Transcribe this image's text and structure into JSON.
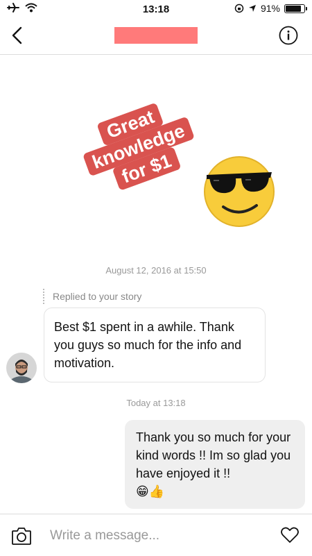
{
  "status_bar": {
    "time": "13:18",
    "battery_text": "91%",
    "battery_level": 0.91
  },
  "story": {
    "sticker_lines": [
      "Great",
      "knowledge",
      "for $1"
    ],
    "emoji": "sunglasses-face"
  },
  "thread": {
    "story_date": "August 12, 2016 at 15:50",
    "replied_label": "Replied to your story",
    "incoming_message": "Best $1 spent in a awhile. Thank you guys so much for the info and motivation.",
    "today_label": "Today at 13:18",
    "outgoing_message": "Thank you so much for your kind words !! Im so glad you have enjoyed it !!",
    "outgoing_emojis": "😁👍"
  },
  "composer": {
    "placeholder": "Write a message..."
  },
  "colors": {
    "sticker_bg": "#d9534f",
    "title_redaction": "#ff7a7a",
    "outgoing_bubble": "#efefef"
  }
}
